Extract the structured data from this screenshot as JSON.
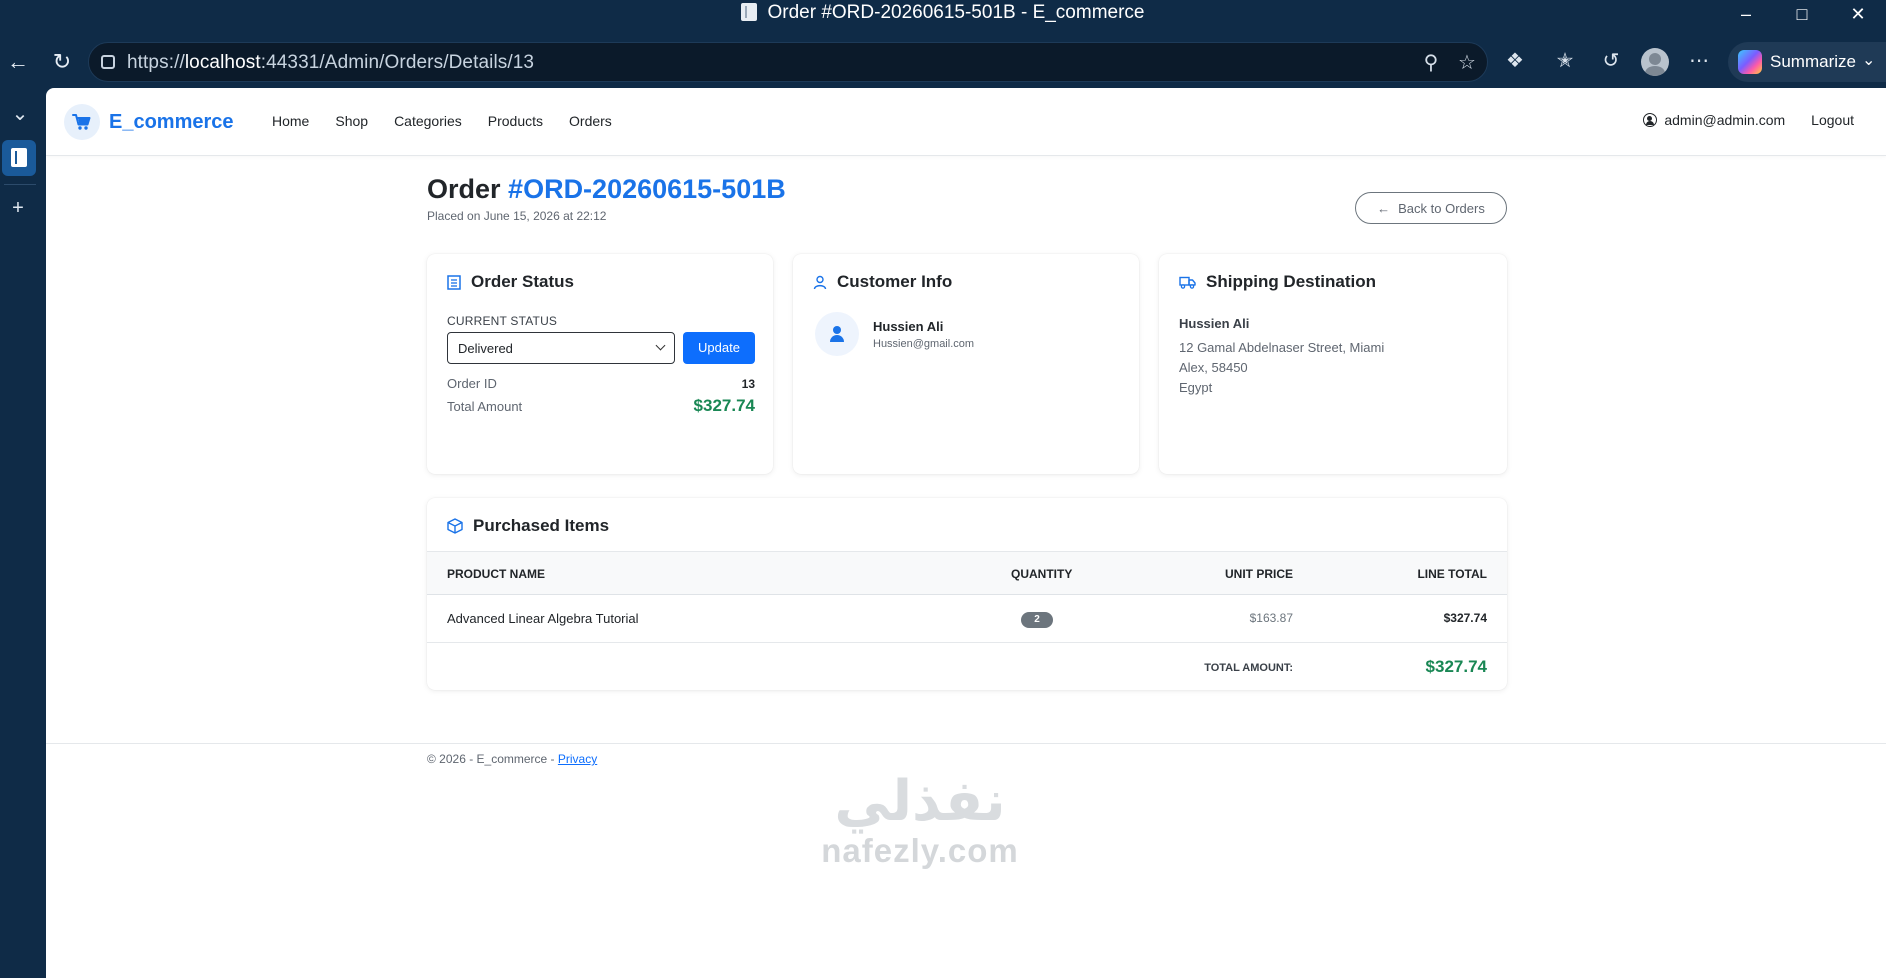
{
  "window": {
    "title": "Order #ORD-20260615-501B - E_commerce"
  },
  "browser": {
    "url_prefix": "https://",
    "url_host": "localhost",
    "url_rest": ":44331/Admin/Orders/Details/13",
    "summarize_label": "Summarize"
  },
  "site": {
    "brand": "E_commerce",
    "nav": [
      "Home",
      "Shop",
      "Categories",
      "Products",
      "Orders"
    ],
    "user_email": "admin@admin.com",
    "logout_label": "Logout"
  },
  "order": {
    "title_prefix": "Order",
    "number": "#ORD-20260615-501B",
    "placed_text": "Placed on June 15, 2026 at 22:12",
    "back_label": "Back to Orders"
  },
  "status_card": {
    "title": "Order Status",
    "current_status_label": "CURRENT STATUS",
    "selected_status": "Delivered",
    "update_label": "Update",
    "order_id_label": "Order ID",
    "order_id_value": "13",
    "total_label": "Total Amount",
    "total_value": "$327.74"
  },
  "customer_card": {
    "title": "Customer Info",
    "name": "Hussien Ali",
    "email": "Hussien@gmail.com"
  },
  "shipping_card": {
    "title": "Shipping Destination",
    "name": "Hussien Ali",
    "lines": [
      "12 Gamal Abdelnaser Street, Miami",
      "Alex, 58450",
      "Egypt"
    ]
  },
  "items_card": {
    "title": "Purchased Items",
    "columns": [
      "PRODUCT NAME",
      "QUANTITY",
      "UNIT PRICE",
      "LINE TOTAL"
    ],
    "rows": [
      {
        "product": "Advanced Linear Algebra Tutorial",
        "quantity": "2",
        "unit_price": "$163.87",
        "line_total": "$327.74"
      }
    ],
    "total_label": "TOTAL AMOUNT:",
    "total_value": "$327.74"
  },
  "footer": {
    "copyright": "© 2026 - E_commerce - ",
    "privacy_label": "Privacy"
  },
  "watermark": {
    "arabic": "نفذلي",
    "latin": "nafezly.com"
  },
  "colors": {
    "brand_blue": "#1a73e8",
    "primary_button": "#0d6efd",
    "money_green": "#198754",
    "browser_frame": "#0f2b47"
  }
}
